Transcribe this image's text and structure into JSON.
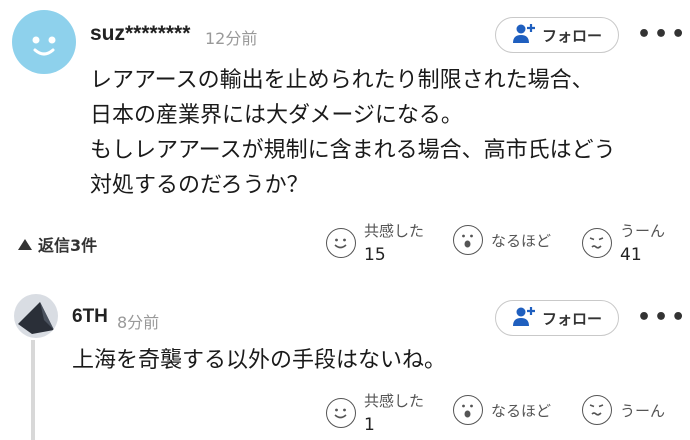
{
  "comments": [
    {
      "username": "suz********",
      "time": "12分前",
      "follow_label": "フォロー",
      "menu_label": "•••",
      "body": [
        "レアアースの輸出を止められたり制限された場合、",
        "日本の産業界には大ダメージになる。",
        "もしレアアースが規制に含まれる場合、高市氏はどう",
        "対処するのだろうか？"
      ],
      "replies_label": "返信3件",
      "reactions": {
        "empathy_label": "共感した",
        "empathy_count": "15",
        "insight_label": "なるほど",
        "hmm_label": "うーん",
        "hmm_count": "41"
      }
    },
    {
      "username": "6TH",
      "time": "8分前",
      "follow_label": "フォロー",
      "menu_label": "•••",
      "body": [
        "上海を奇襲する以外の手段はないね。"
      ],
      "reactions": {
        "empathy_label": "共感した",
        "empathy_count": "1",
        "insight_label": "なるほど",
        "hmm_label": "うーん"
      }
    }
  ],
  "icons": {
    "avatar_1": "smiley-avatar",
    "avatar_2": "dark-shape-avatar",
    "follow": "user-plus-icon",
    "empathy": "smile-icon",
    "insight": "surprised-icon",
    "hmm": "confused-icon",
    "replies": "triangle-up-icon"
  },
  "colors": {
    "avatar_1_bg": "#8ed1ec",
    "follow_icon": "#1f5fbf",
    "text": "#1a1a1a",
    "muted": "#999999"
  }
}
